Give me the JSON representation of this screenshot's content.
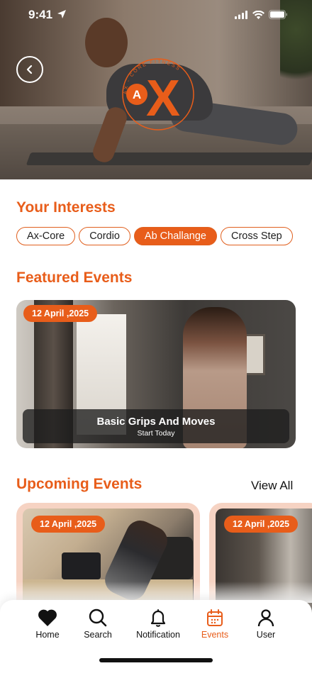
{
  "status_bar": {
    "time": "9:41"
  },
  "hero": {
    "logo_letter_a": "A",
    "logo_letter_x": "X",
    "logo_ring_text": "AX - CORE FITNESS"
  },
  "interests": {
    "title": "Your Interests",
    "chips": [
      {
        "label": "Ax-Core",
        "active": false
      },
      {
        "label": "Cordio",
        "active": false
      },
      {
        "label": "Ab Challange",
        "active": true
      },
      {
        "label": "Cross Step",
        "active": false
      }
    ]
  },
  "featured": {
    "title": "Featured Events",
    "card": {
      "date": "12 April ,2025",
      "event_title": "Basic Grips And Moves",
      "subtitle": "Start Today"
    }
  },
  "upcoming": {
    "title": "Upcoming Events",
    "view_all": "View All",
    "cards": [
      {
        "date": "12 April ,2025"
      },
      {
        "date": "12 April ,2025"
      }
    ]
  },
  "tabbar": {
    "items": [
      {
        "label": "Home",
        "icon": "heart-icon",
        "active": false
      },
      {
        "label": "Search",
        "icon": "search-icon",
        "active": false
      },
      {
        "label": "Notification",
        "icon": "bell-icon",
        "active": false
      },
      {
        "label": "Events",
        "icon": "calendar-icon",
        "active": true
      },
      {
        "label": "User",
        "icon": "user-icon",
        "active": false
      }
    ]
  },
  "colors": {
    "accent": "#e85d1a",
    "card_tint": "#f6d3c3",
    "text": "#111111"
  }
}
